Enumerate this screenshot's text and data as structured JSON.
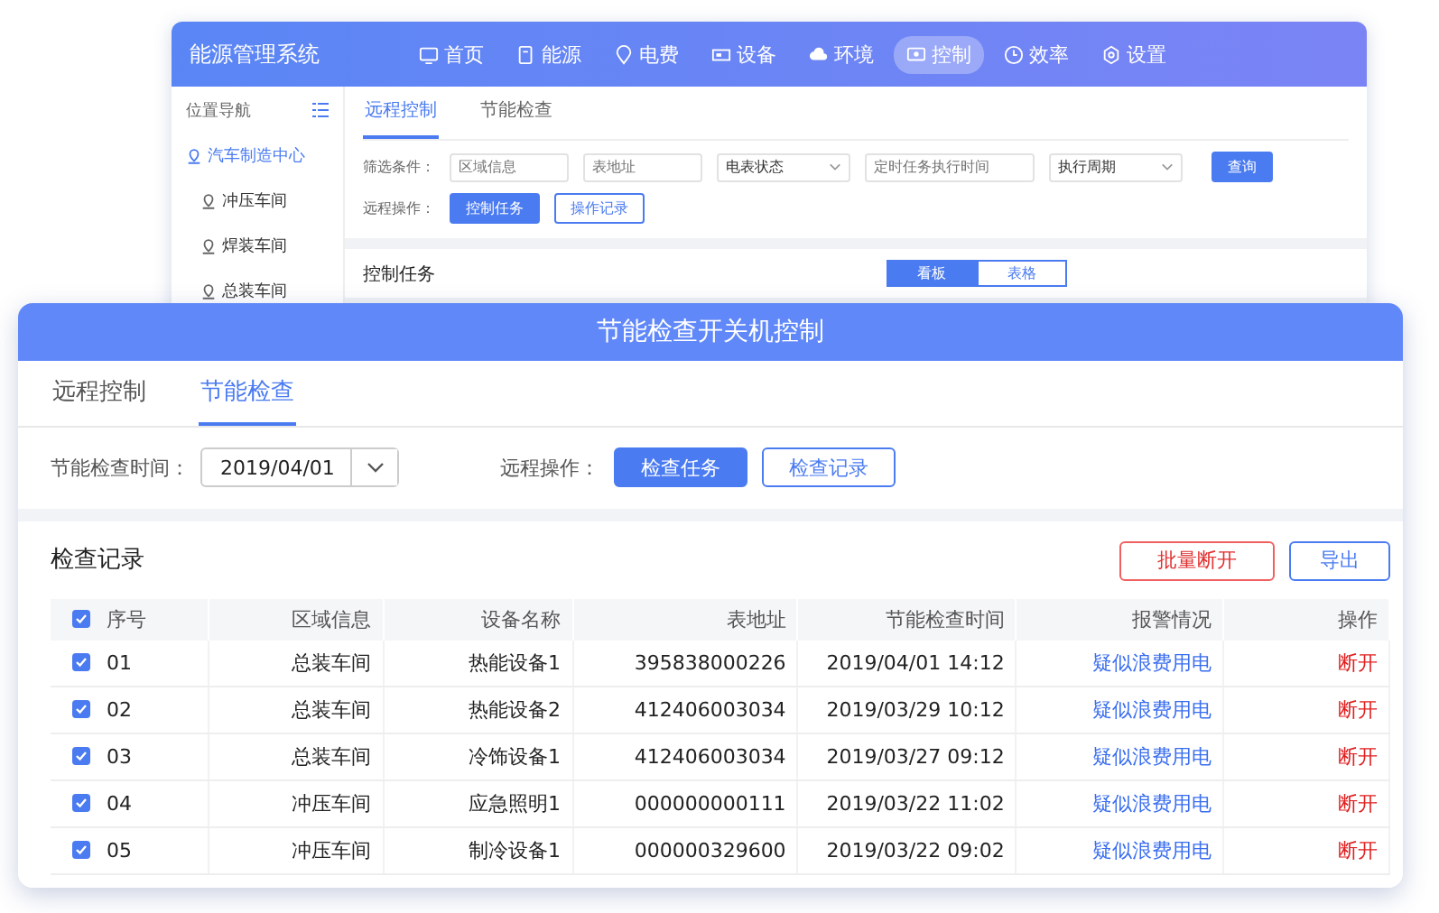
{
  "back_window": {
    "title": "能源管理系统",
    "nav": [
      {
        "label": "首页",
        "selected": false
      },
      {
        "label": "能源",
        "selected": false
      },
      {
        "label": "电费",
        "selected": false
      },
      {
        "label": "设备",
        "selected": false
      },
      {
        "label": "环境",
        "selected": false
      },
      {
        "label": "控制",
        "selected": true
      },
      {
        "label": "效率",
        "selected": false
      },
      {
        "label": "设置",
        "selected": false
      }
    ],
    "sidebar": {
      "title": "位置导航",
      "items": [
        {
          "label": "汽车制造中心",
          "selected": true,
          "children": [
            {
              "label": "冲压车间",
              "selected": false
            },
            {
              "label": "焊装车间",
              "selected": false
            },
            {
              "label": "总装车间",
              "selected": false
            }
          ]
        }
      ]
    },
    "tabs": [
      {
        "label": "远程控制",
        "selected": true
      },
      {
        "label": "节能检查",
        "selected": false
      }
    ],
    "filter": {
      "label": "筛选条件：",
      "fields": [
        {
          "kind": "input",
          "placeholder": "区域信息"
        },
        {
          "kind": "input",
          "placeholder": "表地址"
        },
        {
          "kind": "select",
          "value": "电表状态"
        },
        {
          "kind": "input",
          "placeholder": "定时任务执行时间"
        },
        {
          "kind": "select",
          "value": "执行周期"
        }
      ],
      "button": "查询"
    },
    "operations": {
      "label": "远程操作：",
      "buttons": [
        {
          "label": "控制任务",
          "primary": true
        },
        {
          "label": "操作记录",
          "primary": false
        }
      ]
    },
    "card": {
      "title": "控制任务",
      "views": [
        {
          "label": "看板",
          "selected": true
        },
        {
          "label": "表格",
          "selected": false
        }
      ]
    }
  },
  "dialog": {
    "title": "节能检查开关机控制",
    "tabs": [
      {
        "label": "远程控制",
        "selected": false
      },
      {
        "label": "节能检查",
        "selected": true
      }
    ],
    "date_label": "节能检查时间：",
    "date_value": "2019/04/01",
    "operations": {
      "label": "远程操作：",
      "buttons": [
        {
          "label": "检查任务",
          "primary": true
        },
        {
          "label": "检查记录",
          "primary": false
        }
      ]
    },
    "records": {
      "title": "检查记录",
      "actions": [
        {
          "label": "批量断开",
          "kind": "danger"
        },
        {
          "label": "导出",
          "kind": "default"
        }
      ],
      "all_checked": true,
      "columns": [
        "序号",
        "区域信息",
        "设备名称",
        "表地址",
        "节能检查时间",
        "报警情况",
        "操作"
      ],
      "rows": [
        {
          "checked": true,
          "cells": [
            "01",
            "总装车间",
            "热能设备1",
            "395838000226",
            "2019/04/01 14:12",
            "疑似浪费用电",
            "断开"
          ]
        },
        {
          "checked": true,
          "cells": [
            "02",
            "总装车间",
            "热能设备2",
            "412406003034",
            "2019/03/29 10:12",
            "疑似浪费用电",
            "断开"
          ]
        },
        {
          "checked": true,
          "cells": [
            "03",
            "总装车间",
            "冷饰设备1",
            "412406003034",
            "2019/03/27 09:12",
            "疑似浪费用电",
            "断开"
          ]
        },
        {
          "checked": true,
          "cells": [
            "04",
            "冲压车间",
            "应急照明1",
            "000000000111",
            "2019/03/22 11:02",
            "疑似浪费用电",
            "断开"
          ]
        },
        {
          "checked": true,
          "cells": [
            "05",
            "冲压车间",
            "制冷设备1",
            "000000329600",
            "2019/03/22 09:02",
            "疑似浪费用电",
            "断开"
          ]
        }
      ]
    }
  }
}
